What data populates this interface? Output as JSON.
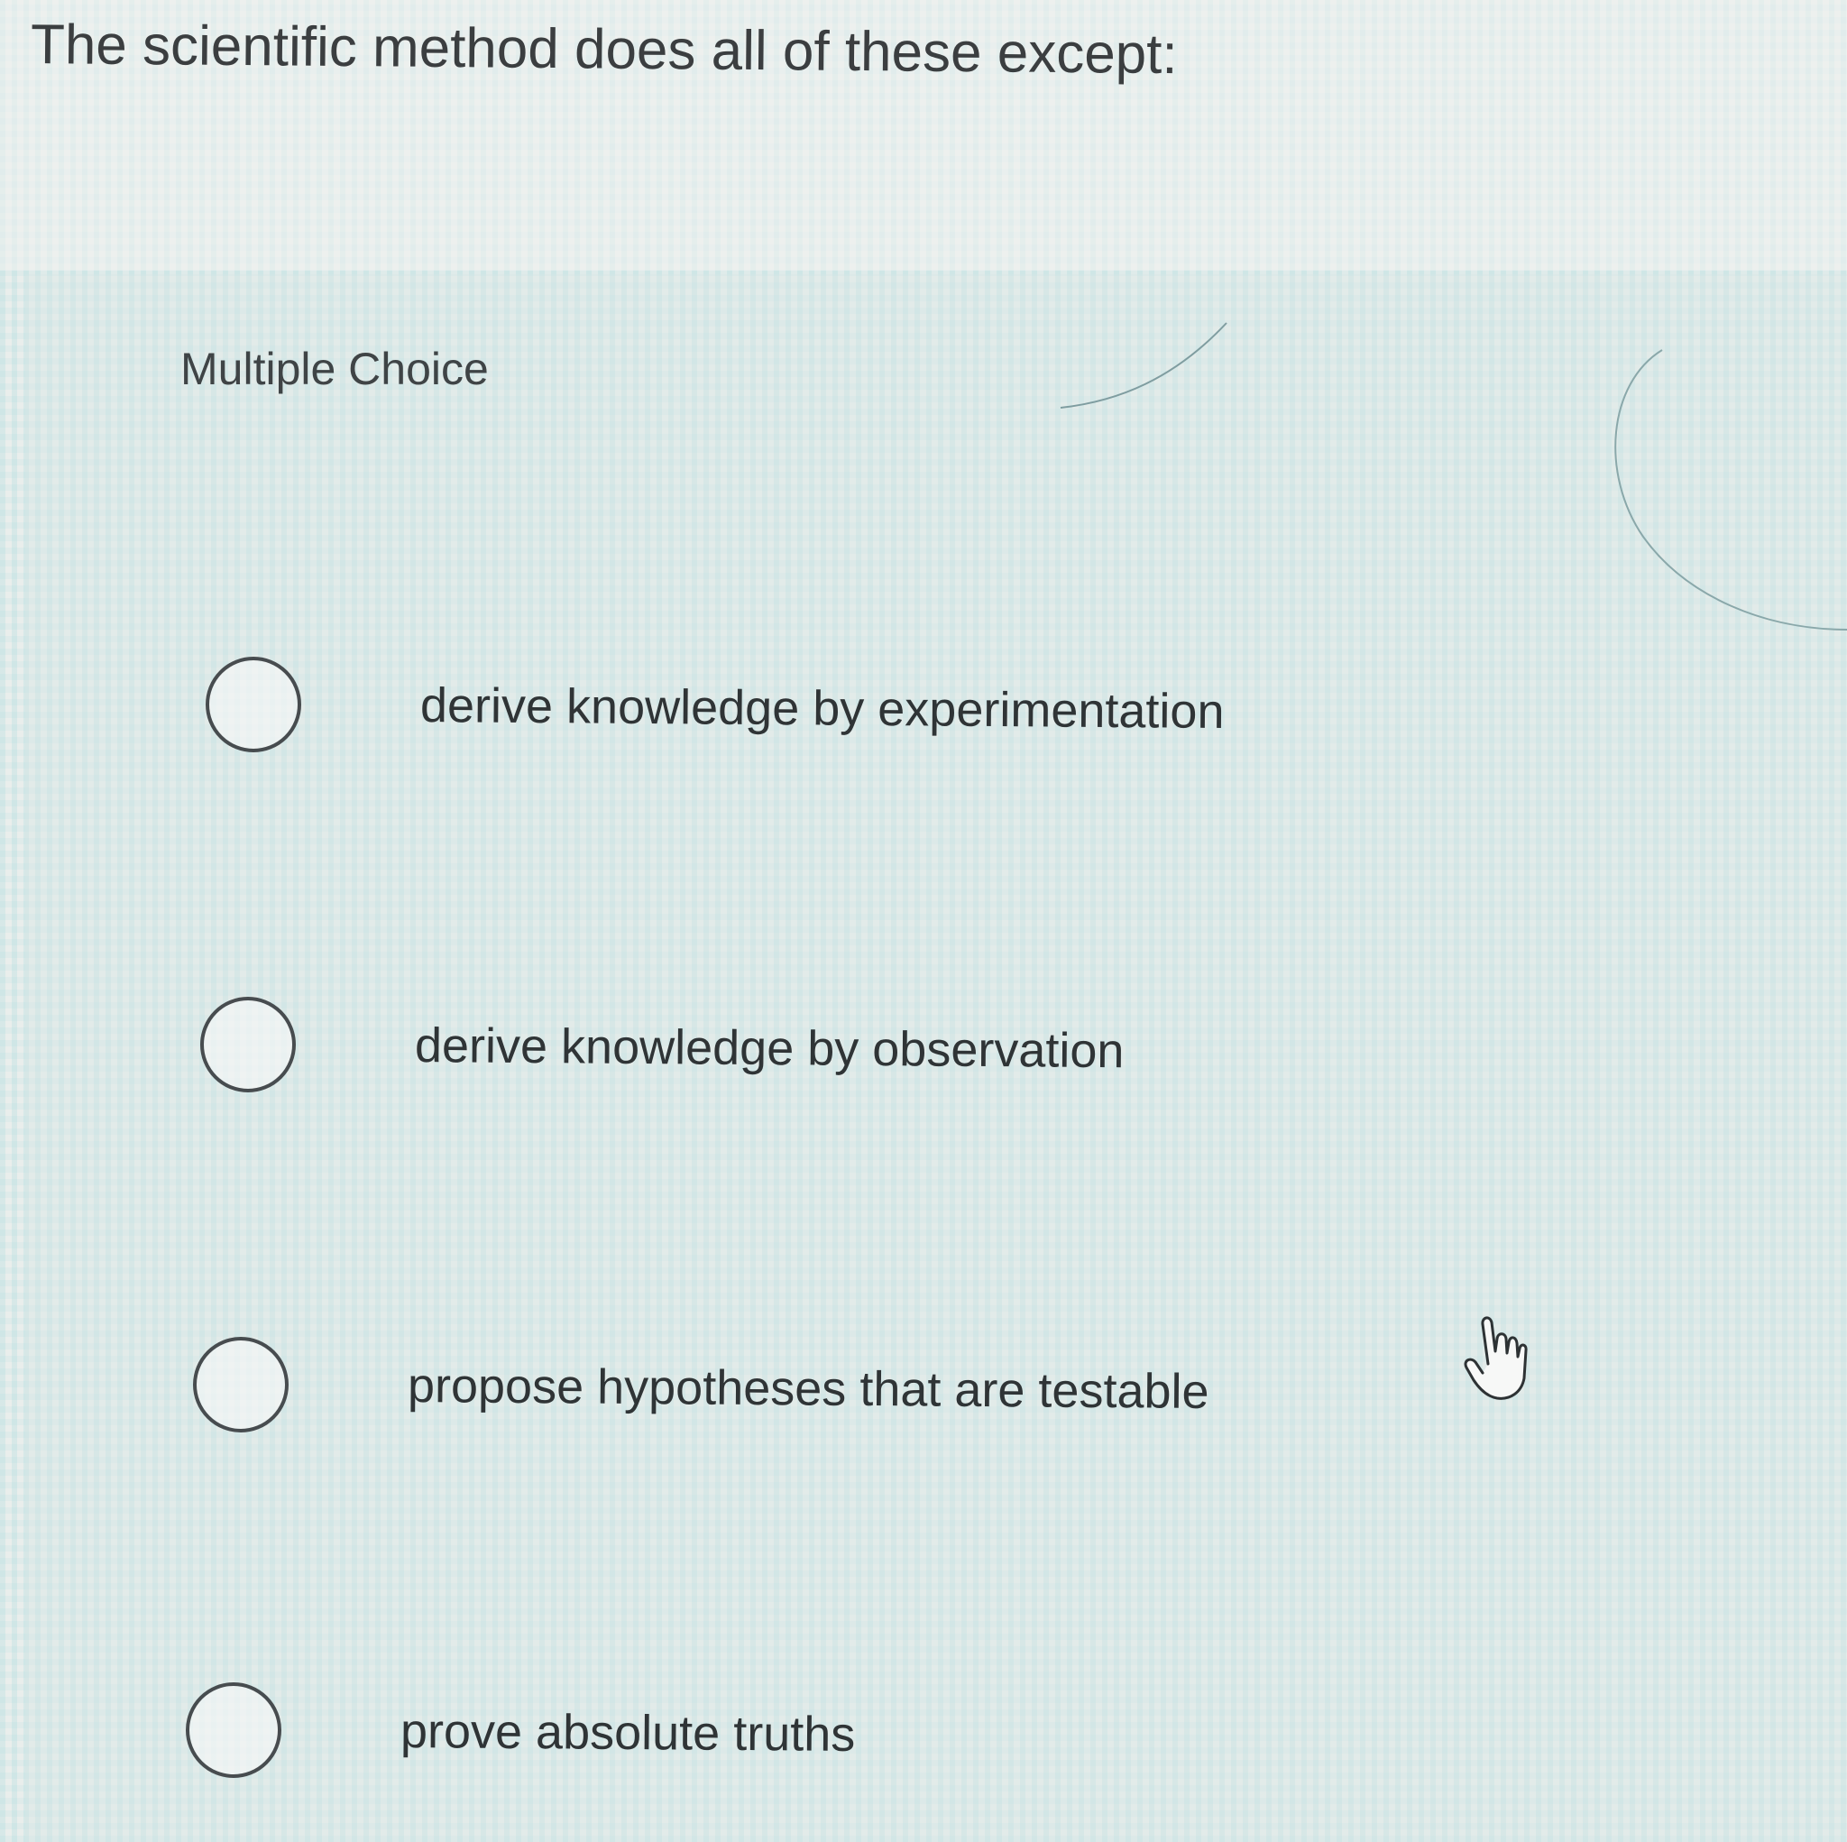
{
  "question": {
    "text": "The scientific method does all of these except:"
  },
  "answer_section": {
    "label": "Multiple Choice",
    "options": [
      {
        "label": "derive knowledge by experimentation",
        "selected": false
      },
      {
        "label": "derive knowledge by observation",
        "selected": false
      },
      {
        "label": "propose hypotheses that are testable",
        "selected": false
      },
      {
        "label": "prove absolute truths",
        "selected": false
      }
    ]
  },
  "cursor": {
    "icon": "pointer-hand-icon"
  }
}
